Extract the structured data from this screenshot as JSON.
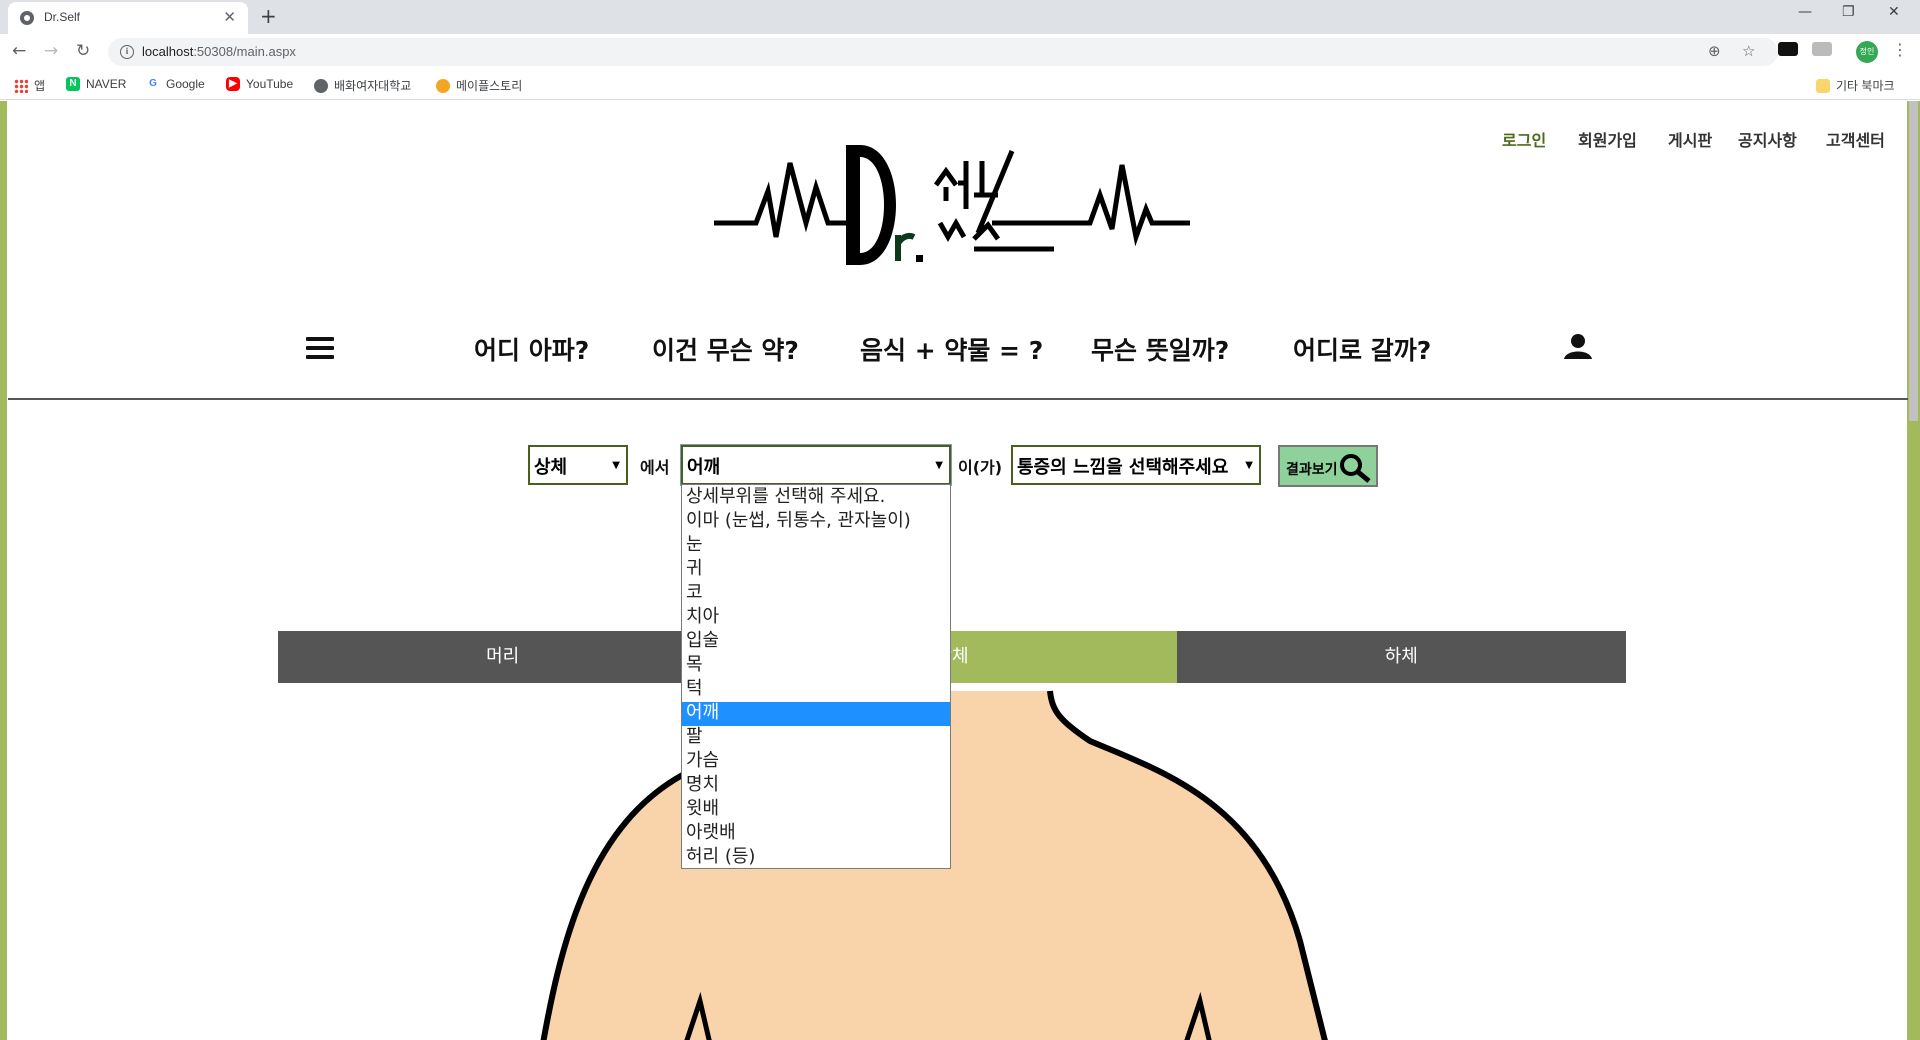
{
  "browser": {
    "tab_title": "Dr.Self",
    "url_host": "localhost",
    "url_rest": ":50308/main.aspx",
    "bookmarks": [
      "앱",
      "NAVER",
      "Google",
      "YouTube",
      "배화여자대학교",
      "메이플스토리"
    ],
    "other_bookmarks": "기타 북마크",
    "profile_label": "정인"
  },
  "site": {
    "top_menu": [
      "로그인",
      "회원가입",
      "게시판",
      "공지사항",
      "고객센터"
    ],
    "main_menu": [
      "어디 아파?",
      "이건 무슨 약?",
      "음식 + 약물 = ?",
      "무슨 뜻일까?",
      "어디로 갈까?"
    ]
  },
  "search": {
    "part_value": "상체",
    "connector1": "에서",
    "detail_value": "어깨",
    "connector2": "이(가)",
    "feeling_value": "통증의 느낌을 선택해주세요",
    "result_label": "결과보기"
  },
  "detail_options": [
    "상세부위를 선택해 주세요.",
    "이마 (눈썹, 뒤통수, 관자놀이)",
    "눈",
    "귀",
    "코",
    "치아",
    "입술",
    "목",
    "턱",
    "어깨",
    "팔",
    "가슴",
    "명치",
    "윗배",
    "아랫배",
    "허리 (등)"
  ],
  "selected_option_index": 9,
  "body_tabs": [
    "머리",
    "상체",
    "하체"
  ],
  "active_body_tab": 1,
  "colors": {
    "accent_green": "#a3ba5c",
    "tab_dark": "#555555",
    "button_green": "#8ed19b",
    "skin": "#f9d4ab",
    "highlight_blue": "#1e90ff"
  }
}
